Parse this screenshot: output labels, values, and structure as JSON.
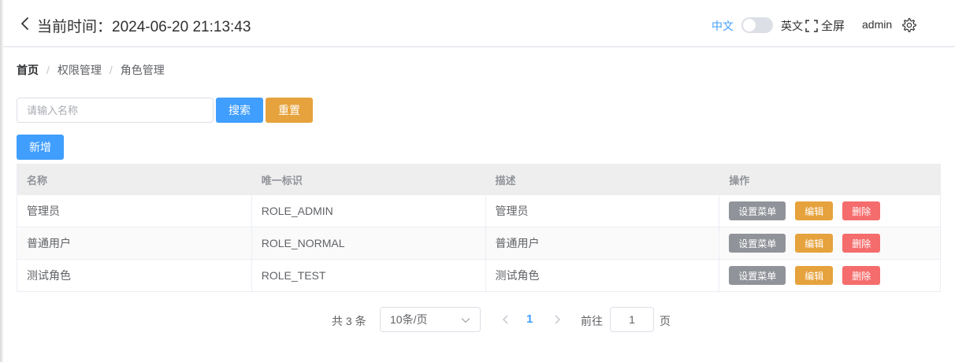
{
  "header": {
    "time_label": "当前时间：2024-06-20 21:13:43",
    "lang_zh": "中文",
    "lang_en": "英文",
    "fullscreen_label": "全屏",
    "username": "admin"
  },
  "breadcrumb": [
    "首页",
    "权限管理",
    "角色管理"
  ],
  "breadcrumb_separator": "/",
  "search": {
    "placeholder": "请输入名称",
    "value": "",
    "search_label": "搜索",
    "reset_label": "重置"
  },
  "add_label": "新增",
  "table": {
    "columns": [
      "名称",
      "唯一标识",
      "描述",
      "操作"
    ],
    "rows": [
      {
        "name": "管理员",
        "key": "ROLE_ADMIN",
        "desc": "管理员"
      },
      {
        "name": "普通用户",
        "key": "ROLE_NORMAL",
        "desc": "普通用户"
      },
      {
        "name": "测试角色",
        "key": "ROLE_TEST",
        "desc": "测试角色"
      }
    ],
    "actions": {
      "menu": "设置菜单",
      "edit": "编辑",
      "delete": "删除"
    }
  },
  "pagination": {
    "total_text": "共 3 条",
    "page_size": "10条/页",
    "current_page": "1",
    "goto_label": "前往",
    "goto_value": "1",
    "page_suffix": "页"
  },
  "colors": {
    "primary": "#409eff",
    "warning": "#e6a23c",
    "danger": "#f56c6c",
    "info": "#909399"
  }
}
